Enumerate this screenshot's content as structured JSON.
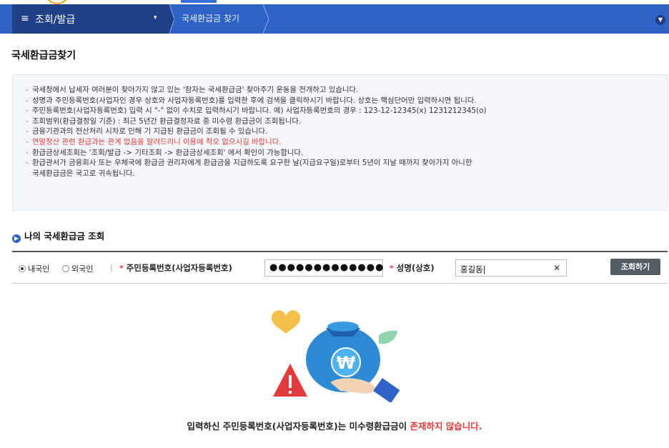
{
  "nav": {
    "menu_icon": "hamburger-icon",
    "menu_title": "조회/발급",
    "menu_caret": "▾",
    "breadcrumb": "국세환급금 찾기",
    "expand_icon": "chevron-down-icon",
    "colors": {
      "nav": "#2f62c5",
      "menu_bg": "#1f3f86"
    }
  },
  "page": {
    "title": "국세환급금찾기"
  },
  "notice": {
    "items": [
      "국세청에서 납세자 여러분이 찾아가지 않고 있는 '잠자는 국세환급금' 찾아주기 운동을 전개하고 있습니다.",
      "성명과 주민등록번호(사업자인 경우 상호와 사업자등록번호)를 입력한 후에 검색을 클릭하시기 바랍니다. 상호는 핵심단어만 입력하시면 됩니다.",
      "주민등록번호(사업자등록번호) 입력 시 \"-\" 없이 수치로 입력하시기 바랍니다. 예) 사업자등록번호의 경우 : 123-12-12345(x) 1231212345(o)",
      "조회범위(환급결정일 기준) : 최근 5년간 환급결정자료 중 미수령 환급금이 조회됩니다.",
      "금융기관과의 전산처리 시차로 인해 기 지급된 환급금이 조회될 수 있습니다.",
      "연말정산 관련 환급과는 관계 없음을 알려드리니 이용에 착오 없으시길 바랍니다.",
      "환급금상세조회는 '조회/발급 -> 기타조회 -> 환급금상세조회' 에서 확인이 가능합니다.",
      "환급관서가 금융회사 또는 우체국에 환급금 권리자에게 환급금을 지급하도록 요구한 날(지급요구일)로부터 5년이 지날 때까지 찾아가지 아니한",
      "국세환급금은 국고로 귀속됩니다."
    ],
    "highlight_color": "#e23b3b"
  },
  "section": {
    "icon": "arrow-circle-icon",
    "title": "나의 국세환급금 조회"
  },
  "search": {
    "radio_domestic": "내국인",
    "radio_foreign": "외국인",
    "selected": "내국인",
    "separator": "|",
    "required_mark": "*",
    "id_label": "주민등록번호(사업자등록번호)",
    "id_value": "●●●●●●●●●●●●●",
    "name_label": "성명(상호)",
    "name_value": "홍길동|",
    "clear_icon": "close-icon",
    "submit_label": "조회하기"
  },
  "result": {
    "illustration": "money-bag-warning-illustration",
    "message_prefix": "입력하신 주민등록번호(사업자등록번호)는 미수령환급금이 ",
    "message_highlight": "존재하지 않습니다."
  }
}
